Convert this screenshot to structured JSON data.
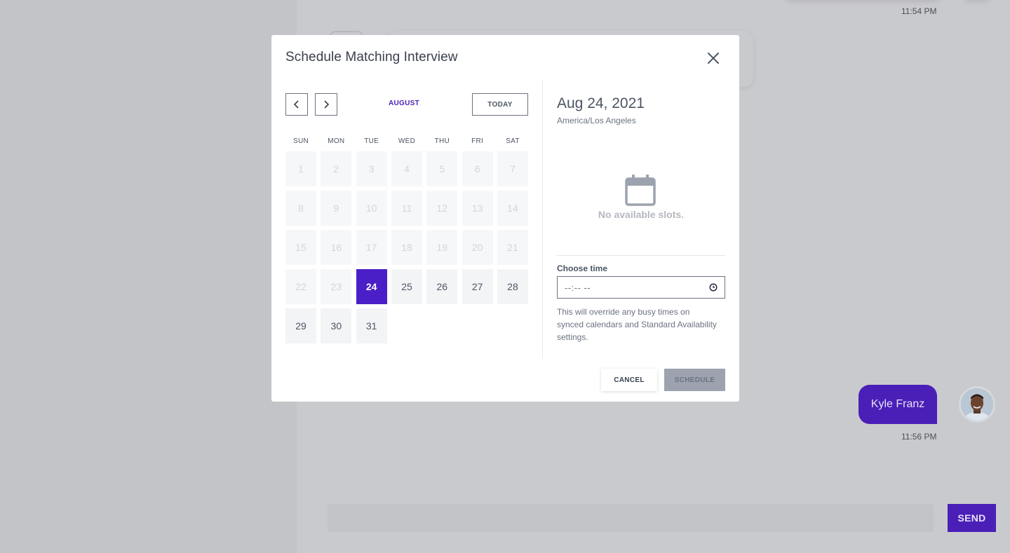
{
  "chat": {
    "timestamp_top": "11:54 PM",
    "timestamp_bottom": "11:56 PM",
    "user_bubble": "Kyle Franz",
    "send_label": "SEND"
  },
  "modal": {
    "title": "Schedule Matching Interview",
    "month": "AUGUST",
    "today_label": "TODAY",
    "weekdays": [
      "SUN",
      "MON",
      "TUE",
      "WED",
      "THU",
      "FRI",
      "SAT"
    ],
    "weeks": [
      [
        "1",
        "2",
        "3",
        "4",
        "5",
        "6",
        "7"
      ],
      [
        "8",
        "9",
        "10",
        "11",
        "12",
        "13",
        "14"
      ],
      [
        "15",
        "16",
        "17",
        "18",
        "19",
        "20",
        "21"
      ],
      [
        "22",
        "23",
        "24",
        "25",
        "26",
        "27",
        "28"
      ],
      [
        "29",
        "30",
        "31"
      ]
    ],
    "selected_day": "24",
    "disabled_through": 23,
    "selected_date_label": "Aug 24, 2021",
    "timezone": "America/Los Angeles",
    "no_slots_text": "No available slots.",
    "choose_time_label": "Choose time",
    "time_value": "--:-- --",
    "override_note": "This will override any busy times on synced calendars and Standard Availability settings.",
    "cancel_label": "CANCEL",
    "schedule_label": "SCHEDULE"
  },
  "colors": {
    "accent": "#4a1fc8",
    "overlay_bg": "#c9cacd",
    "disabled_button": "#9ca3af"
  }
}
